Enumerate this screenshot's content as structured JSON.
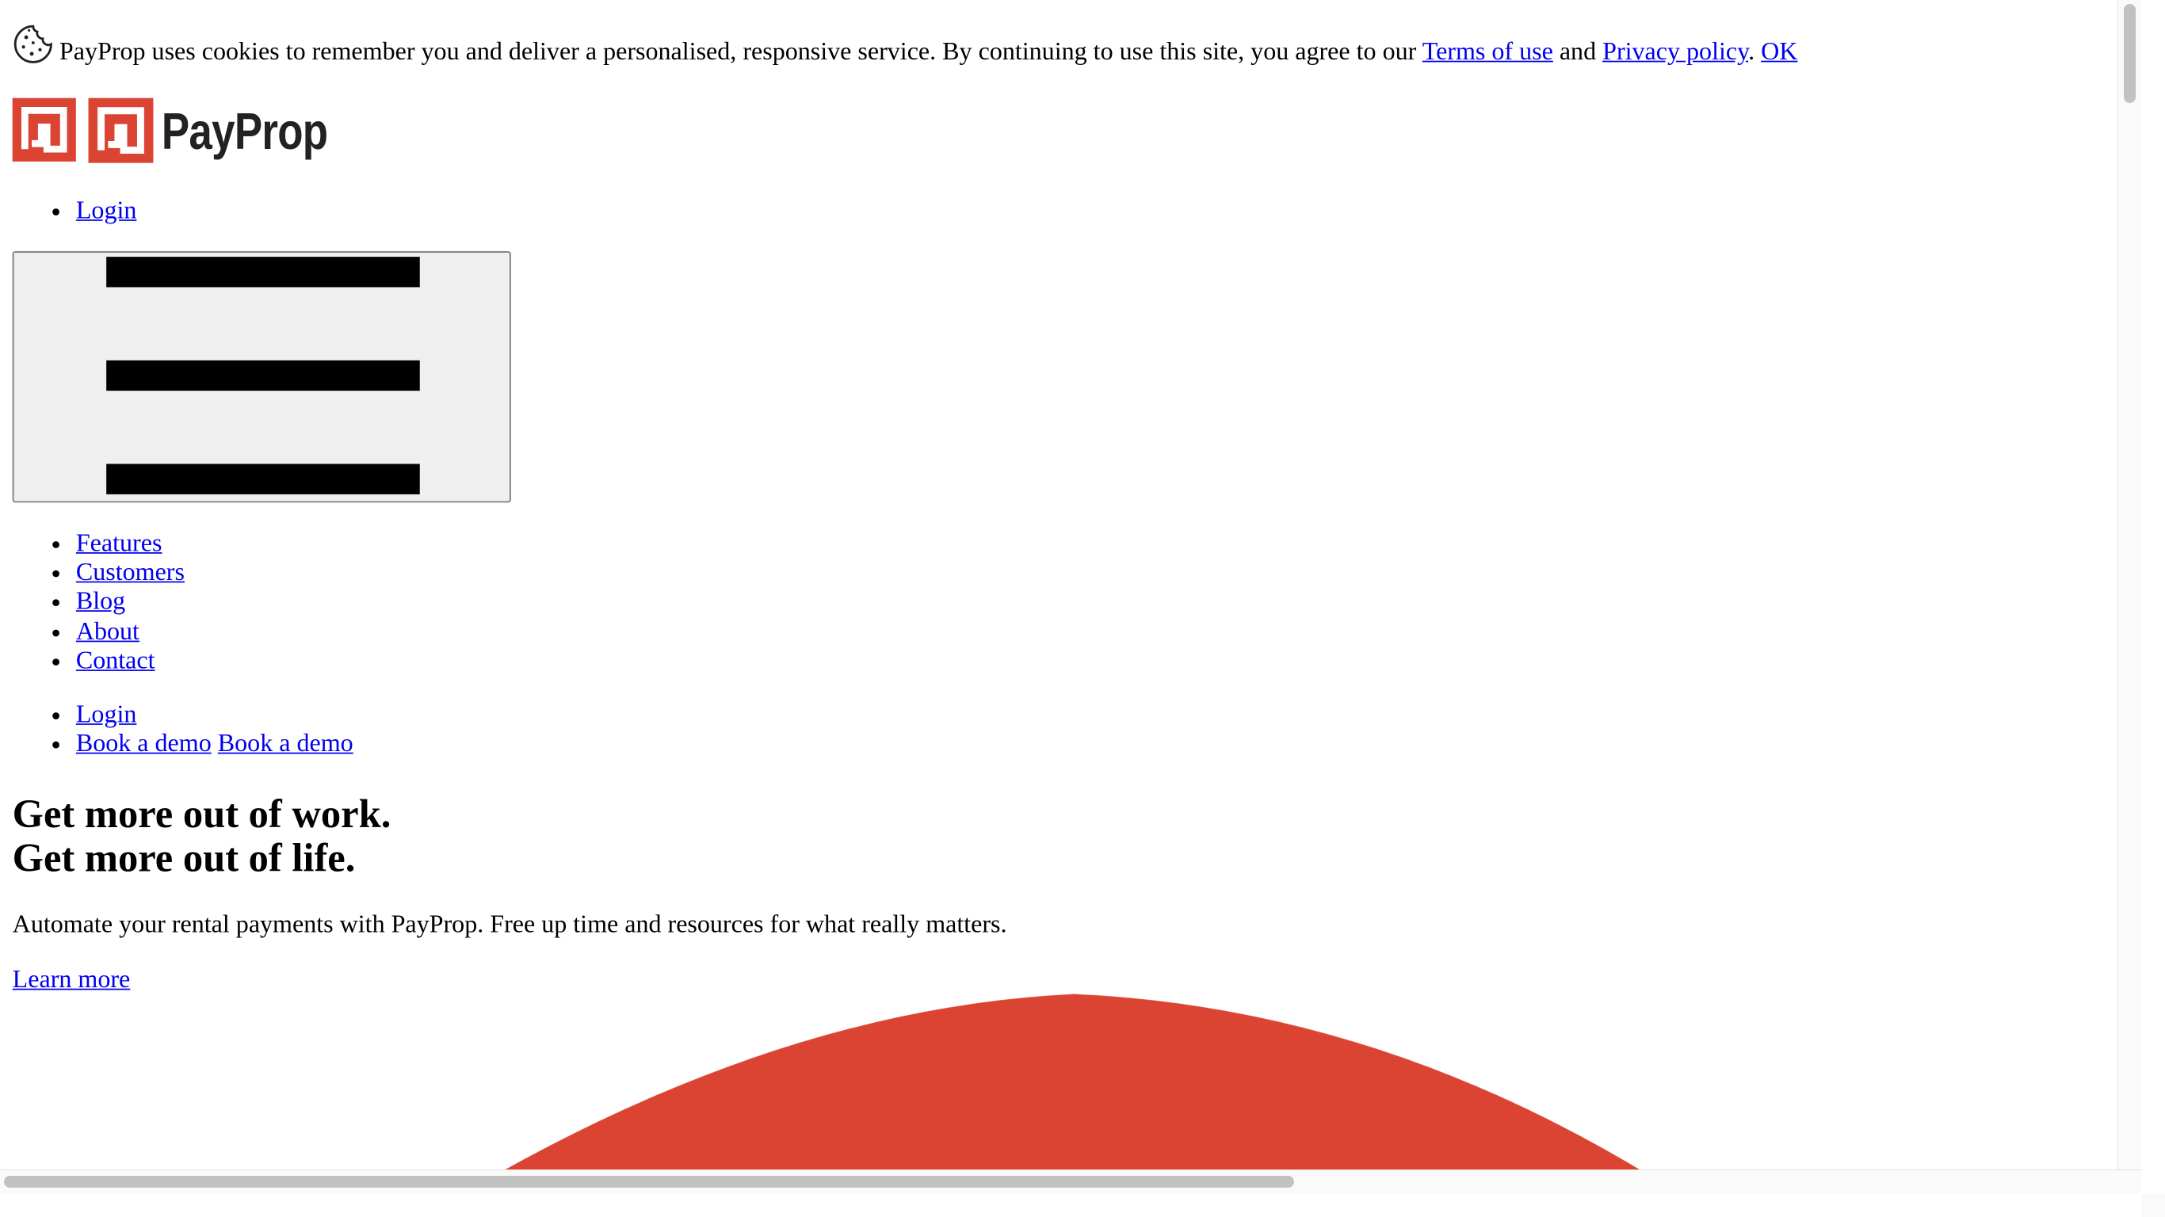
{
  "cookie_bar": {
    "icon": "cookie-icon",
    "text": "PayProp uses cookies to remember you and deliver a personalised, responsive service. By continuing to use this site, you agree to our ",
    "terms_link": "Terms of use",
    "and_text": " and ",
    "privacy_link": "Privacy policy",
    "period": ".",
    "ok_link": "OK"
  },
  "header": {
    "logo_text": "PayProp",
    "brand_color": "#db4433",
    "top_nav": [
      "Login"
    ],
    "menu_toggle_icon": "hamburger-menu-icon"
  },
  "nav": {
    "items": [
      "Features",
      "Customers",
      "Blog",
      "About",
      "Contact"
    ]
  },
  "secondary_nav": {
    "login": "Login",
    "book_demo_1": "Book a demo",
    "book_demo_2": "Book a demo"
  },
  "hero": {
    "title_line1": "Get more out of work.",
    "title_line2": "Get more out of life.",
    "subtitle": "Automate your rental payments with PayProp. Free up time and resources for what really matters.",
    "cta": "Learn more"
  }
}
